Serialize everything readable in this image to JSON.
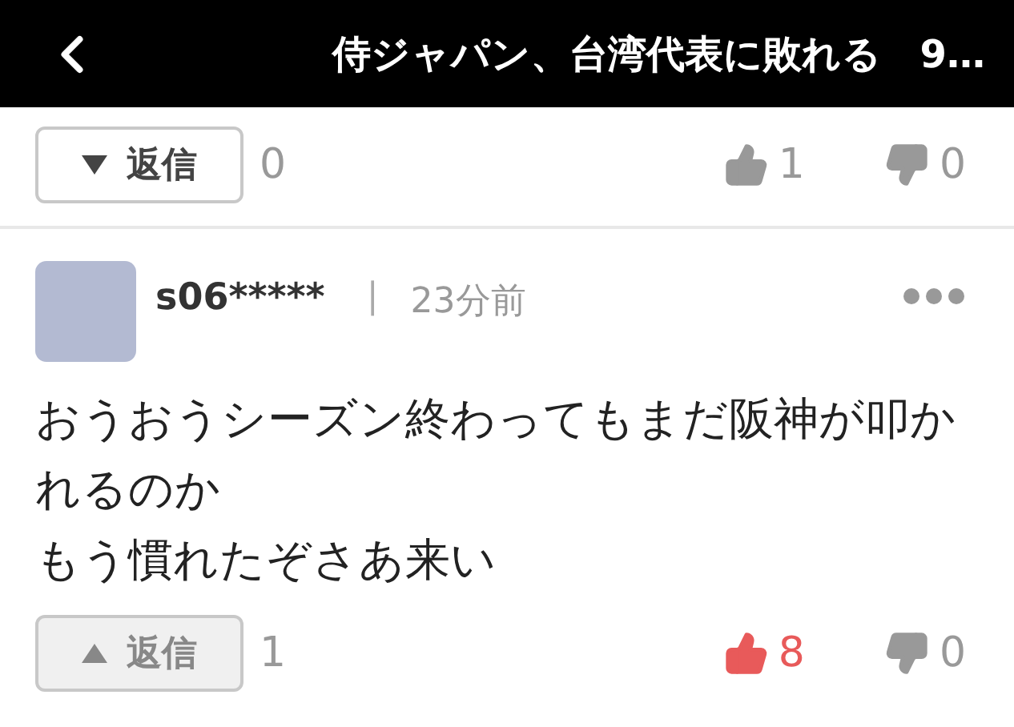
{
  "header": {
    "title": "侍ジャパン、台湾代表に敗れる　9…"
  },
  "previous_comment_actions": {
    "reply_label": "返信",
    "replies_expanded": false,
    "reply_count": "0",
    "likes": "1",
    "liked": false,
    "dislikes": "0"
  },
  "comment": {
    "user": "s06*****",
    "separator": "|",
    "time": "23分前",
    "body": [
      "おうおうシーズン終わってもまだ阪神が叩かれるのか",
      "もう慣れたぞさあ来い"
    ],
    "actions": {
      "reply_label": "返信",
      "replies_expanded": true,
      "reply_count": "1",
      "likes": "8",
      "liked": true,
      "dislikes": "0"
    }
  }
}
